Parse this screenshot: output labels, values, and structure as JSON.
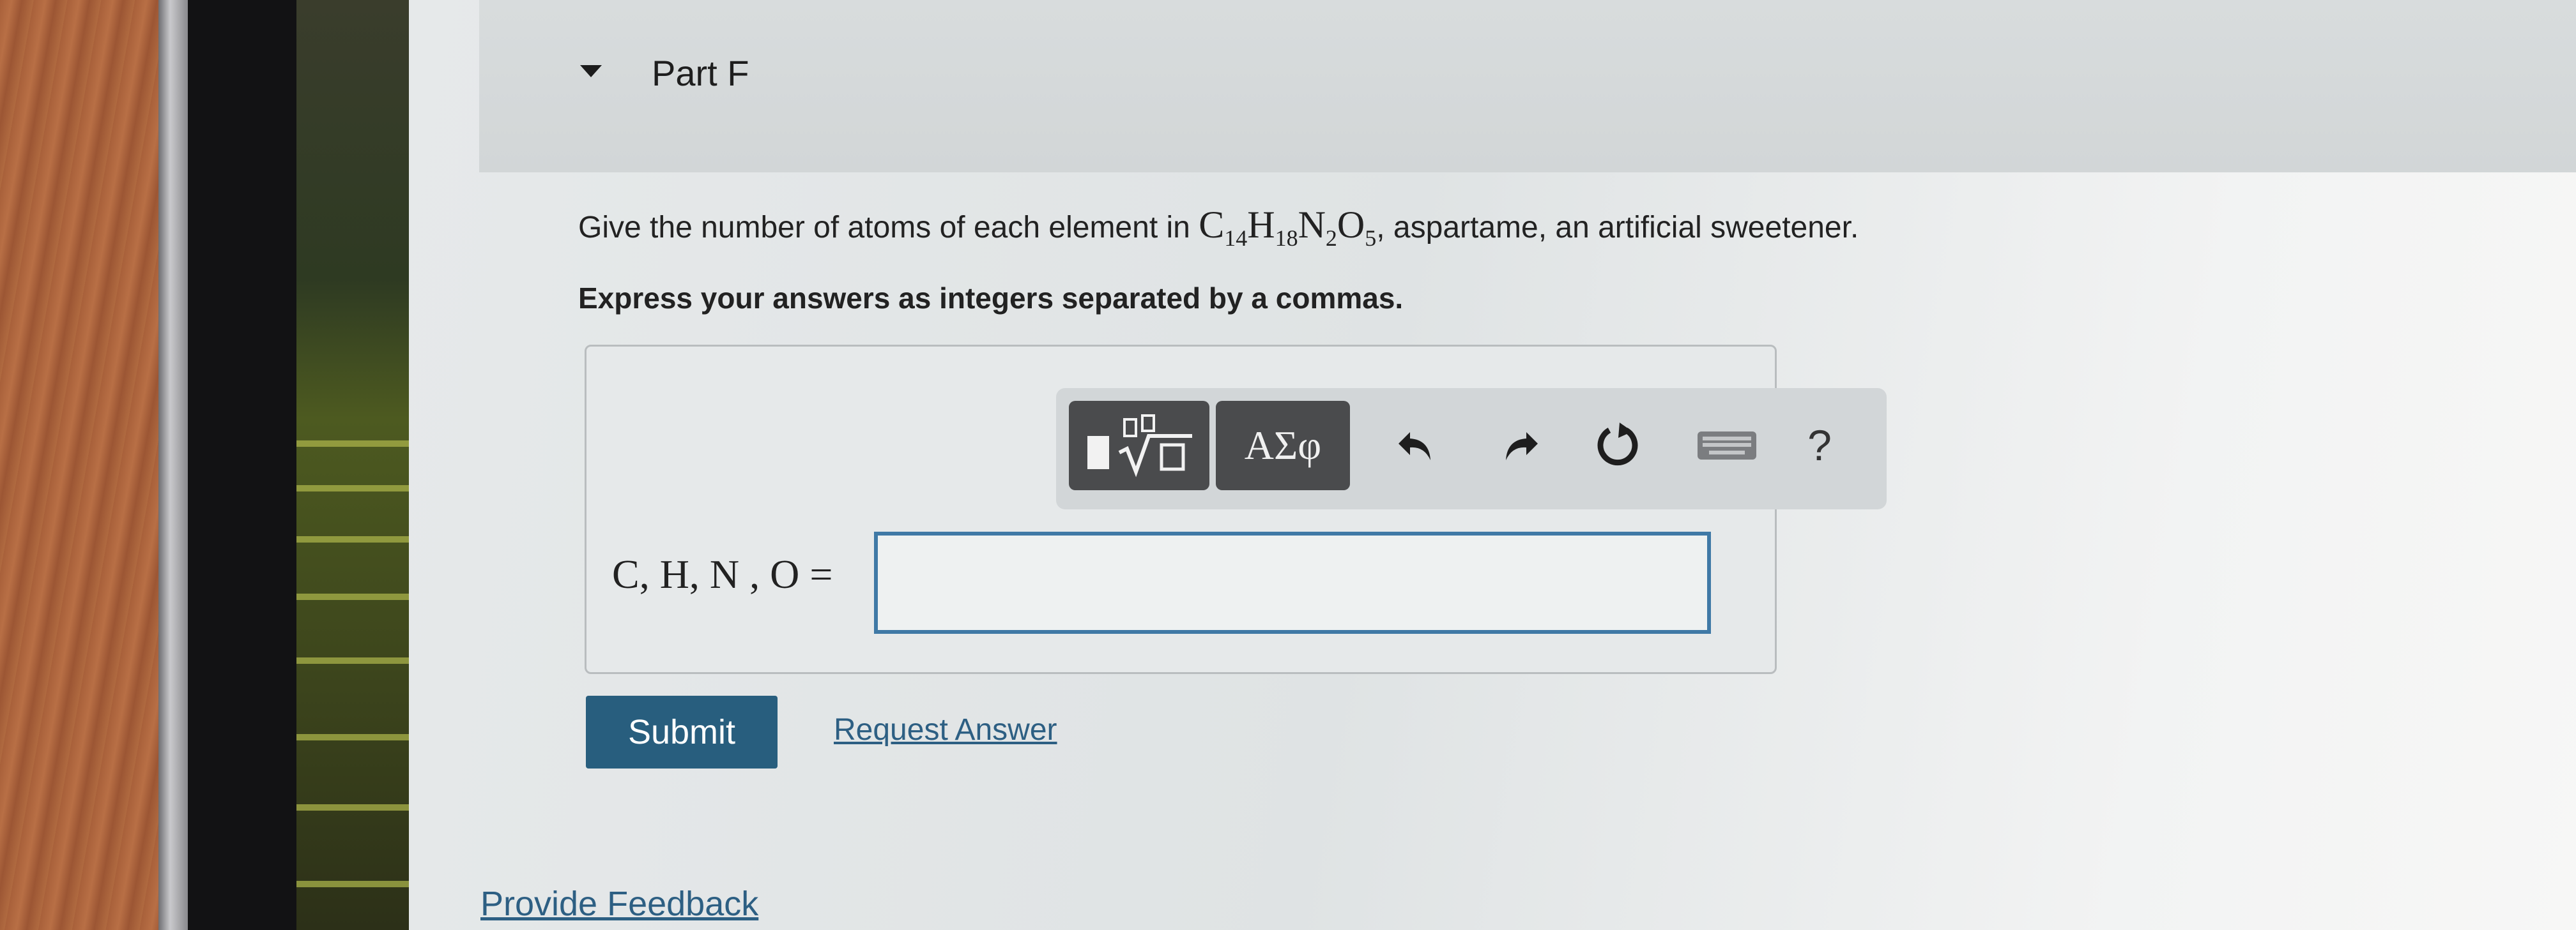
{
  "part": {
    "title": "Part F"
  },
  "question": {
    "prefix": "Give the number of atoms of each element in ",
    "formula": [
      {
        "el": "C",
        "n": "14"
      },
      {
        "el": "H",
        "n": "18"
      },
      {
        "el": "N",
        "n": "2"
      },
      {
        "el": "O",
        "n": "5"
      }
    ],
    "suffix": ", aspartame, an artificial sweetener.",
    "instruction": "Express your answers as integers separated by a commas."
  },
  "toolbar": {
    "greek_label": "ΑΣφ",
    "help_label": "?",
    "icons": [
      "templates-icon",
      "greek-symbols-icon",
      "undo-icon",
      "redo-icon",
      "reset-icon",
      "keyboard-icon",
      "help-icon"
    ]
  },
  "answer": {
    "lhs": "C, H, N , O =",
    "value": ""
  },
  "actions": {
    "submit_label": "Submit",
    "request_answer_label": "Request Answer",
    "feedback_label": "Provide Feedback"
  },
  "colors": {
    "submit_bg": "#285e7e",
    "link": "#2d5f83",
    "input_border": "#3f79a6",
    "toolbar_button": "#4a4b4d"
  }
}
